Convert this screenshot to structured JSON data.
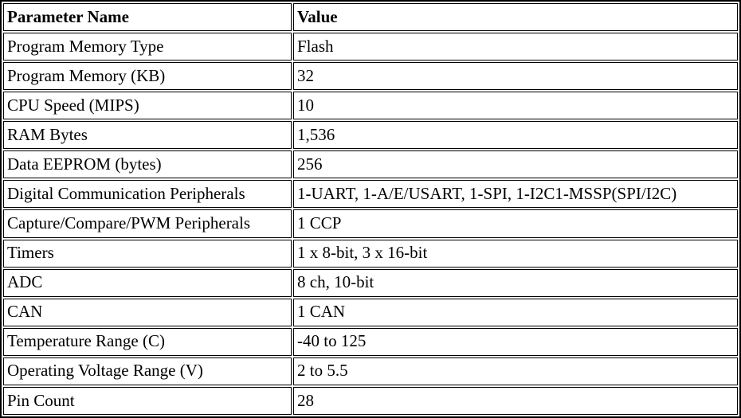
{
  "table": {
    "headers": [
      "Parameter Name",
      "Value"
    ],
    "rows": [
      {
        "parameter": "Program Memory Type",
        "value": "Flash"
      },
      {
        "parameter": "Program Memory (KB)",
        "value": "32"
      },
      {
        "parameter": "CPU Speed (MIPS)",
        "value": "10"
      },
      {
        "parameter": "RAM Bytes",
        "value": "1,536"
      },
      {
        "parameter": "Data EEPROM (bytes)",
        "value": "256"
      },
      {
        "parameter": "Digital Communication Peripherals",
        "value": "1-UART, 1-A/E/USART, 1-SPI, 1-I2C1-MSSP(SPI/I2C)"
      },
      {
        "parameter": "Capture/Compare/PWM Peripherals",
        "value": "1 CCP"
      },
      {
        "parameter": "Timers",
        "value": "1 x 8-bit, 3 x 16-bit"
      },
      {
        "parameter": "ADC",
        "value": "8 ch, 10-bit"
      },
      {
        "parameter": "CAN",
        "value": "1 CAN"
      },
      {
        "parameter": "Temperature Range (C)",
        "value": "-40 to 125"
      },
      {
        "parameter": "Operating Voltage Range (V)",
        "value": "2 to 5.5"
      },
      {
        "parameter": "Pin Count",
        "value": "28"
      }
    ]
  },
  "colors": {
    "background": "#ffffff",
    "border": "#000000",
    "text": "#000000"
  }
}
